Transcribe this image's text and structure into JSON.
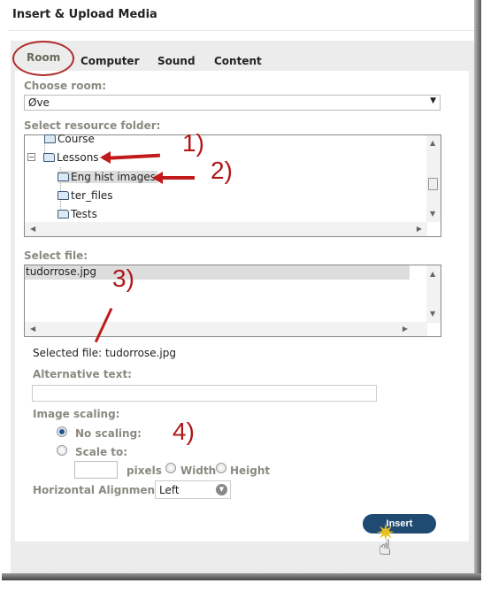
{
  "dialog": {
    "title": "Insert & Upload Media"
  },
  "tabs": [
    {
      "label": "Room",
      "active": true
    },
    {
      "label": "Computer"
    },
    {
      "label": "Sound"
    },
    {
      "label": "Content"
    }
  ],
  "room": {
    "label": "Choose room:",
    "value": "Øve"
  },
  "folder": {
    "label": "Select resource folder:",
    "items": [
      {
        "label": "Course",
        "level": 1
      },
      {
        "label": "Lessons",
        "level": 1,
        "expanded": true
      },
      {
        "label": "Eng hist images",
        "level": 2,
        "selected": true
      },
      {
        "label": "ter_files",
        "level": 2
      },
      {
        "label": "Tests",
        "level": 2
      }
    ]
  },
  "file": {
    "label": "Select file:",
    "items": [
      {
        "label": "tudorrose.jpg",
        "selected": true
      }
    ]
  },
  "selected_file": "Selected file: tudorrose.jpg",
  "alt": {
    "label": "Alternative text:",
    "value": ""
  },
  "scaling": {
    "label": "Image scaling:",
    "no_scaling": "No scaling:",
    "scale_to": "Scale to:",
    "pixels": "pixels",
    "width": "Width",
    "height": "Height",
    "selected": "No scaling"
  },
  "align": {
    "label": "Horizontal Alignment:",
    "value": "Left"
  },
  "insert_label": "Insert",
  "annotations": [
    "1)",
    "2)",
    "3)",
    "4)"
  ],
  "colors": {
    "annotation": "#b01818",
    "button": "#1f4a72"
  }
}
